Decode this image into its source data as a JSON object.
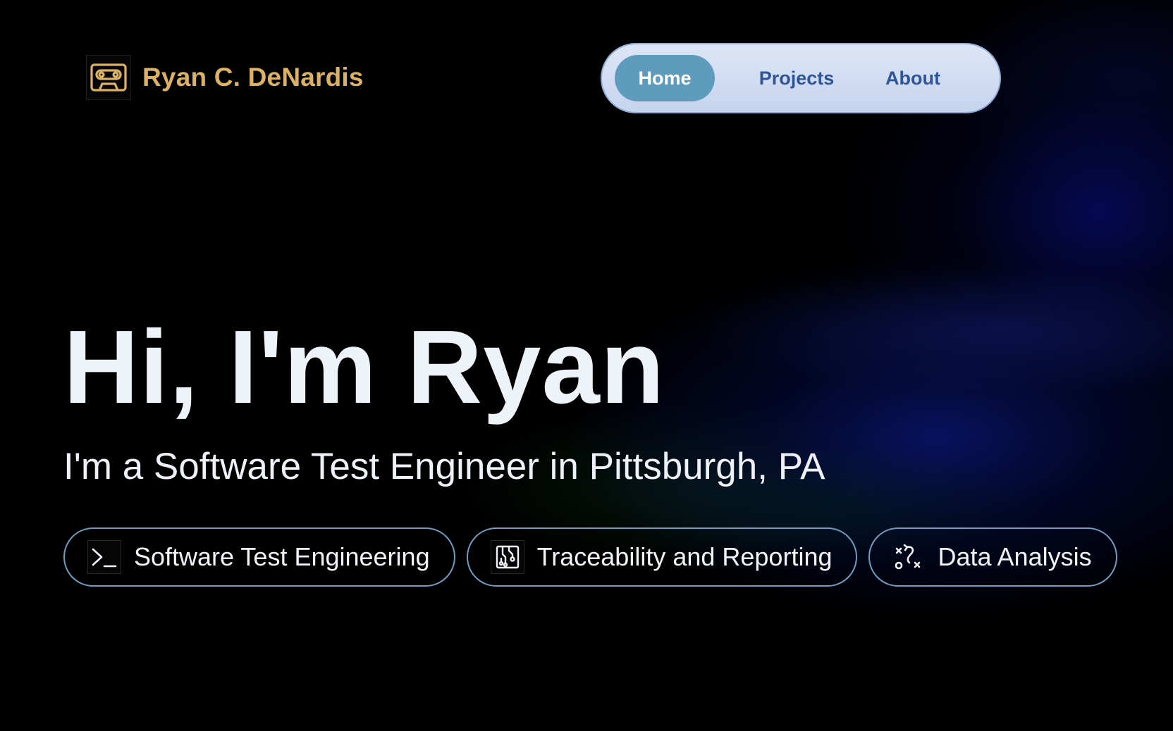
{
  "header": {
    "brand_name": "Ryan C. DeNardis",
    "brand_icon": "cassette-tape-icon",
    "brand_color": "#dcb164"
  },
  "nav": {
    "items": [
      {
        "label": "Home",
        "active": true
      },
      {
        "label": "Projects",
        "active": false
      },
      {
        "label": "About",
        "active": false
      }
    ],
    "active_color": "#5f9bbd",
    "text_color": "#2f5597"
  },
  "hero": {
    "title": "Hi, I'm Ryan",
    "subtitle": "I'm a Software Test Engineer in Pittsburgh, PA"
  },
  "skills": [
    {
      "label": "Software Test Engineering",
      "icon": "terminal-icon"
    },
    {
      "label": "Traceability and Reporting",
      "icon": "circuit-board-icon"
    },
    {
      "label": "Data Analysis",
      "icon": "strategy-path-icon"
    }
  ],
  "colors": {
    "background": "#000000",
    "chip_border": "#6f9cc0"
  }
}
